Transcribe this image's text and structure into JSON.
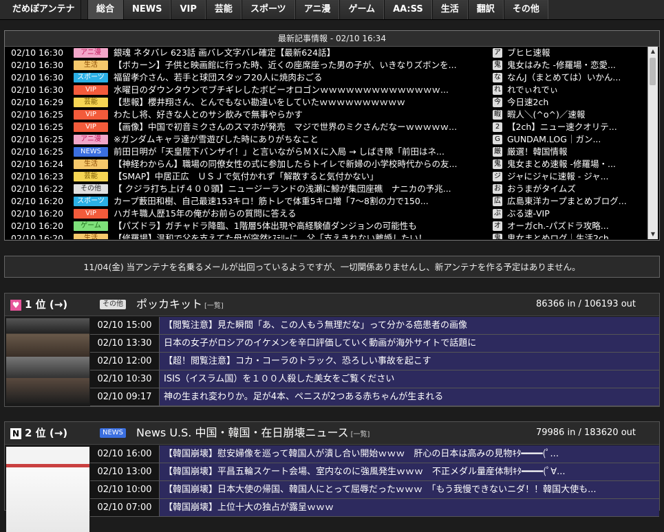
{
  "brand": "だめぽアンテナ",
  "nav_tabs": [
    "総合",
    "NEWS",
    "VIP",
    "芸能",
    "スポーツ",
    "アニ漫",
    "ゲーム",
    "AA:SS",
    "生活",
    "翻訳",
    "その他"
  ],
  "active_tab": "総合",
  "latest": {
    "header": "最新記事情報 - 02/10 16:34",
    "rows": [
      {
        "time": "02/10 16:30",
        "cat": "アニ漫",
        "cat_bg": "#f2a6c9",
        "cat_fg": "#c2185b",
        "title": "銀魂 ネタバレ 623話 画バレ文字バレ確定【最新624話】",
        "icon": "ア",
        "site": "ブヒヒ速報"
      },
      {
        "time": "02/10 16:30",
        "cat": "生活",
        "cat_bg": "#f6c86b",
        "cat_fg": "#8a4a00",
        "title": "【ボカーン】子供と映画館に行った時、近くの座席座った男の子が、いきなりズボンを...",
        "icon": "鬼",
        "site": "鬼女はみた -修羅場・恋愛..."
      },
      {
        "time": "02/10 16:30",
        "cat": "スポーツ",
        "cat_bg": "#2bb0e6",
        "cat_fg": "#ffffff",
        "title": "福留孝介さん、若手と球団スタッフ20人に焼肉おごる",
        "icon": "な",
        "site": "なんJ（まとめては）いかん..."
      },
      {
        "time": "02/10 16:30",
        "cat": "VIP",
        "cat_bg": "#f35b3b",
        "cat_fg": "#ffffff",
        "title": "水曜日のダウンタウンでブチギレしたボビーオロゴンｗｗｗｗｗｗｗｗｗｗｗｗｗｗ...",
        "icon": "れ",
        "site": "れでぃれでぃ"
      },
      {
        "time": "02/10 16:29",
        "cat": "芸能",
        "cat_bg": "#f6d654",
        "cat_fg": "#7a5a00",
        "title": "【悲報】櫻井翔さん、とんでもない勘違いをしていたｗｗｗｗｗｗｗｗｗｗ",
        "icon": "今",
        "site": "今日速2ch"
      },
      {
        "time": "02/10 16:25",
        "cat": "VIP",
        "cat_bg": "#f35b3b",
        "cat_fg": "#ffffff",
        "title": "わたし将、好きな人とのサシ飲みで無事やらかす",
        "icon": "暇",
        "site": "暇人＼(^o^)／速報"
      },
      {
        "time": "02/10 16:25",
        "cat": "VIP",
        "cat_bg": "#f35b3b",
        "cat_fg": "#ffffff",
        "title": "【画像】中国で初音ミクさんのスマホが発売　マジで世界のミクさんだなーｗｗｗｗｗ...",
        "icon": "2",
        "site": "【2ch】ニュー速クオリテ..."
      },
      {
        "time": "02/10 16:25",
        "cat": "アニ漫",
        "cat_bg": "#f2a6c9",
        "cat_fg": "#c2185b",
        "title": "※ガンダムキャラ達が雪遊びした時にありがちなこと",
        "icon": "G",
        "site": "GUNDAM.LOG｜ガン..."
      },
      {
        "time": "02/10 16:25",
        "cat": "NEWS",
        "cat_bg": "#3b6fe0",
        "cat_fg": "#ffffff",
        "title": "前田日明が「天皇陛下バンザイ！」と言いながらＭＸに入局 → しばき隊「前田はネ...",
        "icon": "厳",
        "site": "厳選！韓国情報"
      },
      {
        "time": "02/10 16:24",
        "cat": "生活",
        "cat_bg": "#f6c86b",
        "cat_fg": "#8a4a00",
        "title": "【神経わからん】職場の同僚女性の式に参加したらトイレで新婦の小学校時代からの友...",
        "icon": "鬼",
        "site": "鬼女まとめ速報 -修羅場・..."
      },
      {
        "time": "02/10 16:23",
        "cat": "芸能",
        "cat_bg": "#f6d654",
        "cat_fg": "#7a5a00",
        "title": "【SMAP】中居正広　ＵＳＪで気付かれず「解散すると気付かない」",
        "icon": "ジ",
        "site": "ジャにジャに速報 - ジャ..."
      },
      {
        "time": "02/10 16:22",
        "cat": "その他",
        "cat_bg": "#e0e0e0",
        "cat_fg": "#333333",
        "title": "【 クジラ打ち上げ４００頭】ニュージーランドの浅瀬に鯨が集団座礁　ナニカの予兆...",
        "icon": "お",
        "site": "おうまがタイムズ"
      },
      {
        "time": "02/10 16:20",
        "cat": "スポーツ",
        "cat_bg": "#2bb0e6",
        "cat_fg": "#ffffff",
        "title": "カープ藪田和樹、自己最速153キロ！筋トレで体重5キロ増「7～8割の力で150...",
        "icon": "広",
        "site": "広島東洋カープまとめブログ..."
      },
      {
        "time": "02/10 16:20",
        "cat": "VIP",
        "cat_bg": "#f35b3b",
        "cat_fg": "#ffffff",
        "title": "ハガキ職人歴15年の俺がお前らの質問に答える",
        "icon": "ぶ",
        "site": "ぶる速-VIP"
      },
      {
        "time": "02/10 16:20",
        "cat": "ゲーム",
        "cat_bg": "#7ee07a",
        "cat_fg": "#1e6b1a",
        "title": "【パズドラ】ガチャドラ降臨、1階層5体出現や高経験値ダンジョンの可能性も",
        "icon": "オ",
        "site": "オーガch.-パズドラ攻略..."
      },
      {
        "time": "02/10 16:20",
        "cat": "生活",
        "cat_bg": "#f6c86b",
        "cat_fg": "#8a4a00",
        "title": "【修羅場】温和で父を支えてた母が突然ﾋｽﾃﾘｰに。父「支えきれない離婚したい！...",
        "icon": "鬼",
        "site": "鬼女まとめログ｜生活2ch..."
      }
    ]
  },
  "notice": "11/04(金) 当アンテナを名乗るメールが出回っているようですが、一切関係ありませんし、新アンテナを作る予定はありません。",
  "rankings": [
    {
      "icon": "♥",
      "icon_bg": "#e6549a",
      "rank": "1 位 (→)",
      "cat": "その他",
      "cat_bg": "#e0e0e0",
      "cat_fg": "#333333",
      "name": "ポッカキット",
      "list_link": "[一覧]",
      "io": "86366 in / 106193 out",
      "articles": [
        {
          "date": "02/10 15:00",
          "title": "【閲覧注意】見た瞬間「あ、この人もう無理だな」って分かる癌患者の画像"
        },
        {
          "date": "02/10 13:30",
          "title": "日本の女子がロシアのイケメンを辛口評価していく動画が海外サイトで話題に"
        },
        {
          "date": "02/10 12:00",
          "title": "【超！閲覧注意】コカ・コーラのトラック、恐ろしい事故を起こす"
        },
        {
          "date": "02/10 10:30",
          "title": "ISIS（イスラム国）を１００人殺した美女をご覧ください"
        },
        {
          "date": "02/10 09:17",
          "title": "神の生まれ変わりか。足が4本、ペニスが2つある赤ちゃんが生まれる"
        }
      ]
    },
    {
      "icon": "N",
      "icon_bg": "#ffffff",
      "rank": "2 位 (→)",
      "cat": "NEWS",
      "cat_bg": "#3b6fe0",
      "cat_fg": "#ffffff",
      "name": "News U.S. 中国・韓国・在日崩壊ニュース",
      "list_link": "[一覧]",
      "io": "79986 in / 183620 out",
      "articles": [
        {
          "date": "02/10 16:00",
          "title": "【韓国崩壊】慰安婦像を巡って韓国人が潰し合い開始ｗｗｗ　肝心の日本は高みの見物ｷﾀ━━━━(ﾟ..."
        },
        {
          "date": "02/10 13:00",
          "title": "【韓国崩壊】平昌五輪スケート会場、室内なのに強風発生ｗｗｗ　不正メダル量産体制ｷﾀ━━━━(ﾟ∀..."
        },
        {
          "date": "02/10 10:00",
          "title": "【韓国崩壊】日本大使の帰国、韓国人にとって屈辱だったｗｗｗ　「もう我慢できないニダ！！韓国大使も..."
        },
        {
          "date": "02/10 07:00",
          "title": "【韓国崩壊】上位十大の独占が露呈ｗｗｗ"
        }
      ]
    }
  ]
}
